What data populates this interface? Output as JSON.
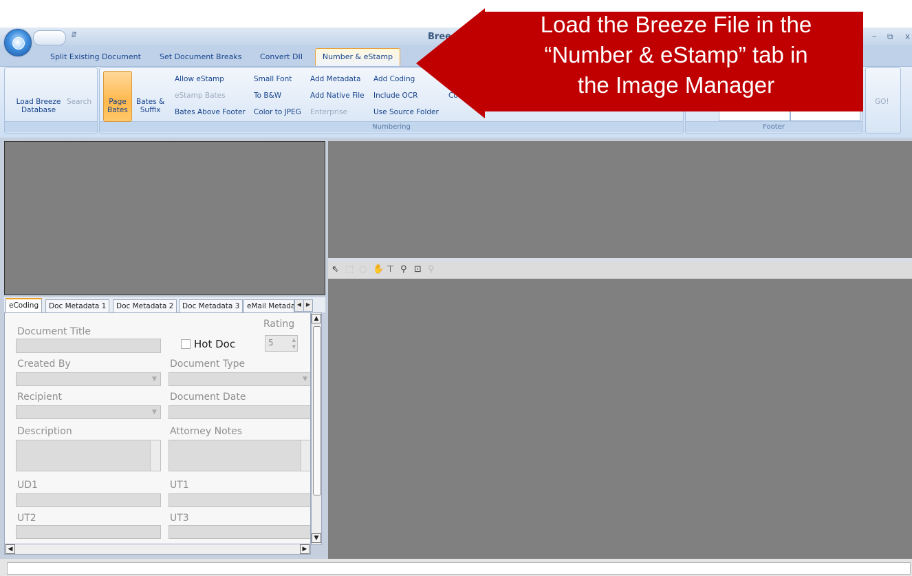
{
  "window": {
    "title": "Bree",
    "minimize": "–",
    "restore": "⧉",
    "close": "x",
    "qat_dropdown": "⇵"
  },
  "tabs": [
    {
      "label": "Split Existing Document"
    },
    {
      "label": "Set Document Breaks"
    },
    {
      "label": "Convert DII"
    },
    {
      "label": "Number & eStamp"
    }
  ],
  "ribbon": {
    "load_breeze_line1": "Load Breeze",
    "load_breeze_line2": "Database",
    "search": "Search",
    "page_bates": "Page Bates",
    "bates_suffix_line1": "Bates &",
    "bates_suffix_line2": "Suffix",
    "allow_estamp": "Allow eStamp",
    "estamp_bates": "eStamp Bates",
    "bates_above_footer": "Bates Above Footer",
    "small_font": "Small Font",
    "to_bw": "To B&W",
    "color_to_jpeg": "Color to JPEG",
    "add_metadata": "Add Metadata",
    "add_native_file": "Add Native File",
    "enterprise": "Enterprise",
    "add_coding": "Add Coding",
    "include_ocr": "Include OCR",
    "use_source_folder": "Use Source Folder",
    "co_partial": "Co",
    "numbering_label": "Numbering",
    "footer_label": "Footer",
    "go": "GO!"
  },
  "callout": {
    "line1": "Load the Breeze File in the",
    "line2": "“Number & eStamp” tab in",
    "line3": "the Image Manager",
    "color": "#c00000"
  },
  "form_tabs": [
    {
      "label": "eCoding"
    },
    {
      "label": "Doc Metadata 1"
    },
    {
      "label": "Doc Metadata 2"
    },
    {
      "label": "Doc Metadata 3"
    },
    {
      "label": "eMail Metadat"
    }
  ],
  "form": {
    "document_title": "Document Title",
    "rating": "Rating",
    "rating_value": "5",
    "hot_doc": "Hot Doc",
    "created_by": "Created By",
    "document_type": "Document Type",
    "recipient": "Recipient",
    "document_date": "Document Date",
    "description": "Description",
    "attorney_notes": "Attorney Notes",
    "ud1": "UD1",
    "ut1": "UT1",
    "ut2": "UT2",
    "ut3": "UT3"
  },
  "toolbar_icons": [
    "pointer-icon",
    "select-rect-icon",
    "lasso-icon",
    "hand-icon",
    "pan-icon",
    "zoom-icon",
    "zoom-rect-icon",
    "magnify-icon"
  ]
}
